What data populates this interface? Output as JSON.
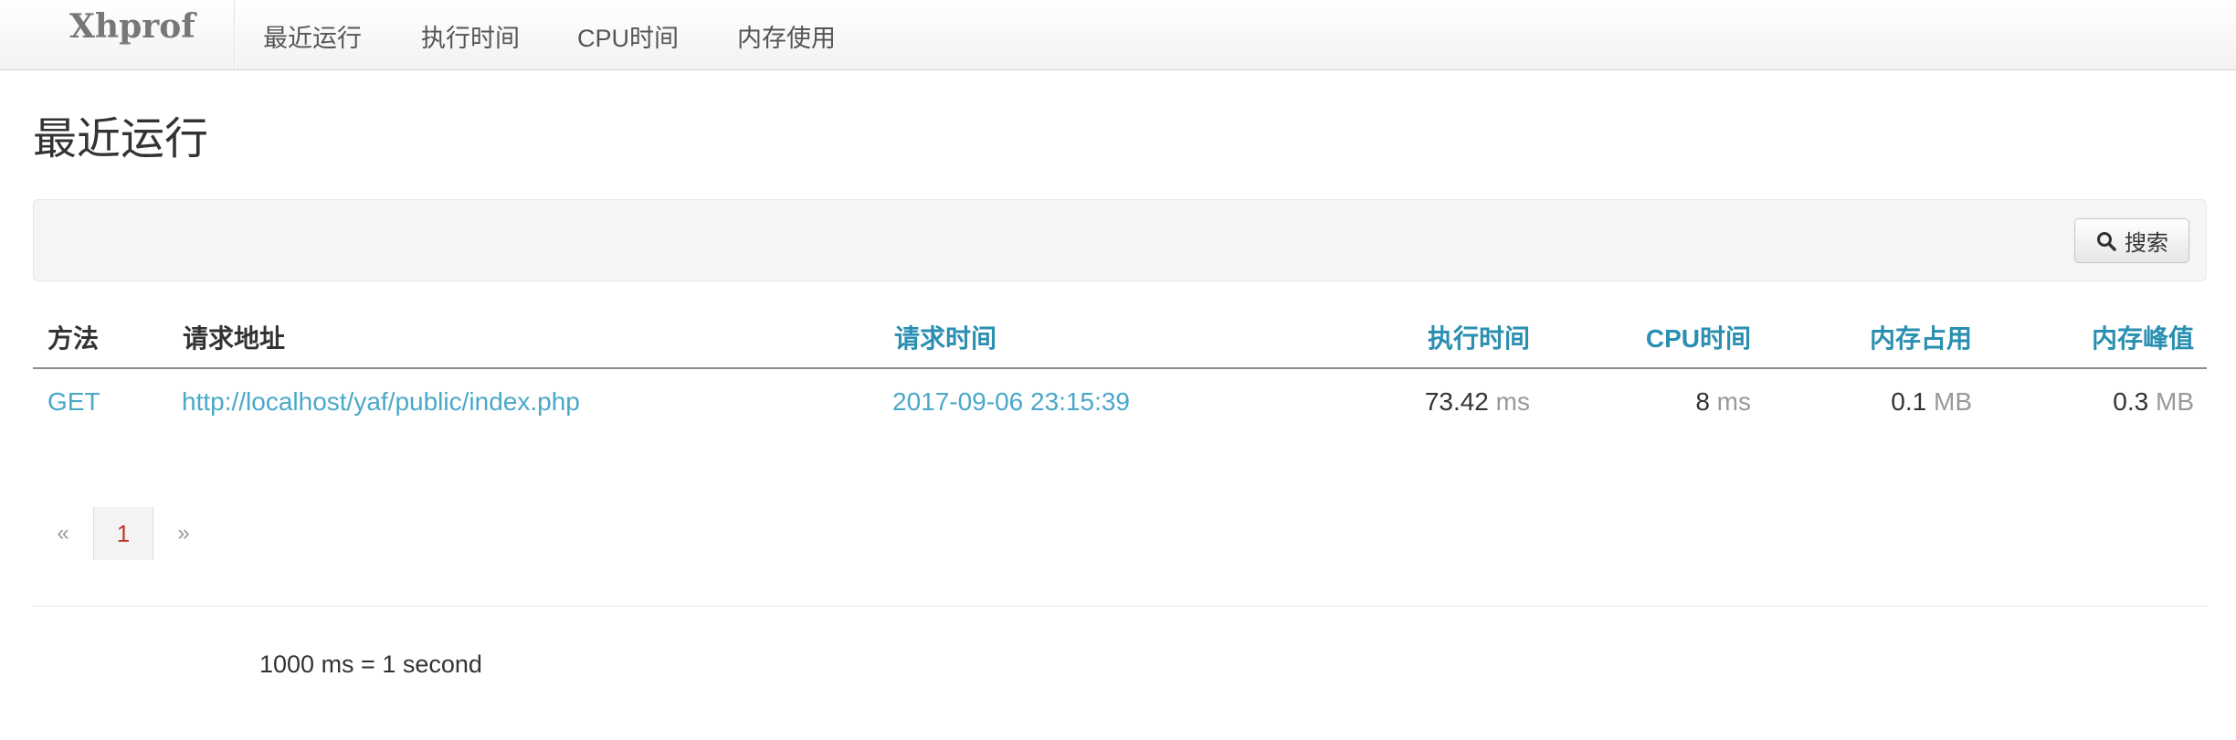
{
  "navbar": {
    "brand": "Xhprof",
    "items": [
      {
        "label": "最近运行"
      },
      {
        "label": "执行时间"
      },
      {
        "label": "CPU时间"
      },
      {
        "label": "内存使用"
      }
    ]
  },
  "page": {
    "title": "最近运行"
  },
  "toolbar": {
    "search_label": "搜索",
    "search_icon": "search-icon"
  },
  "table": {
    "headers": {
      "method": "方法",
      "url": "请求地址",
      "request_time": "请求时间",
      "exec_time": "执行时间",
      "cpu_time": "CPU时间",
      "memory_usage": "内存占用",
      "memory_peak": "内存峰值"
    },
    "rows": [
      {
        "method": "GET",
        "url": "http://localhost/yaf/public/index.php",
        "request_time": "2017-09-06 23:15:39",
        "exec_time": "73.42",
        "exec_unit": "ms",
        "cpu_time": "8",
        "cpu_unit": "ms",
        "memory_usage": "0.1",
        "memory_usage_unit": "MB",
        "memory_peak": "0.3",
        "memory_peak_unit": "MB"
      }
    ]
  },
  "pagination": {
    "prev": "«",
    "current": "1",
    "next": "»"
  },
  "footer": {
    "note": "1000 ms = 1 second"
  },
  "colors": {
    "link": "#4aa8c9",
    "sort_header": "#2a8fb0",
    "active_page": "#c0392b"
  }
}
